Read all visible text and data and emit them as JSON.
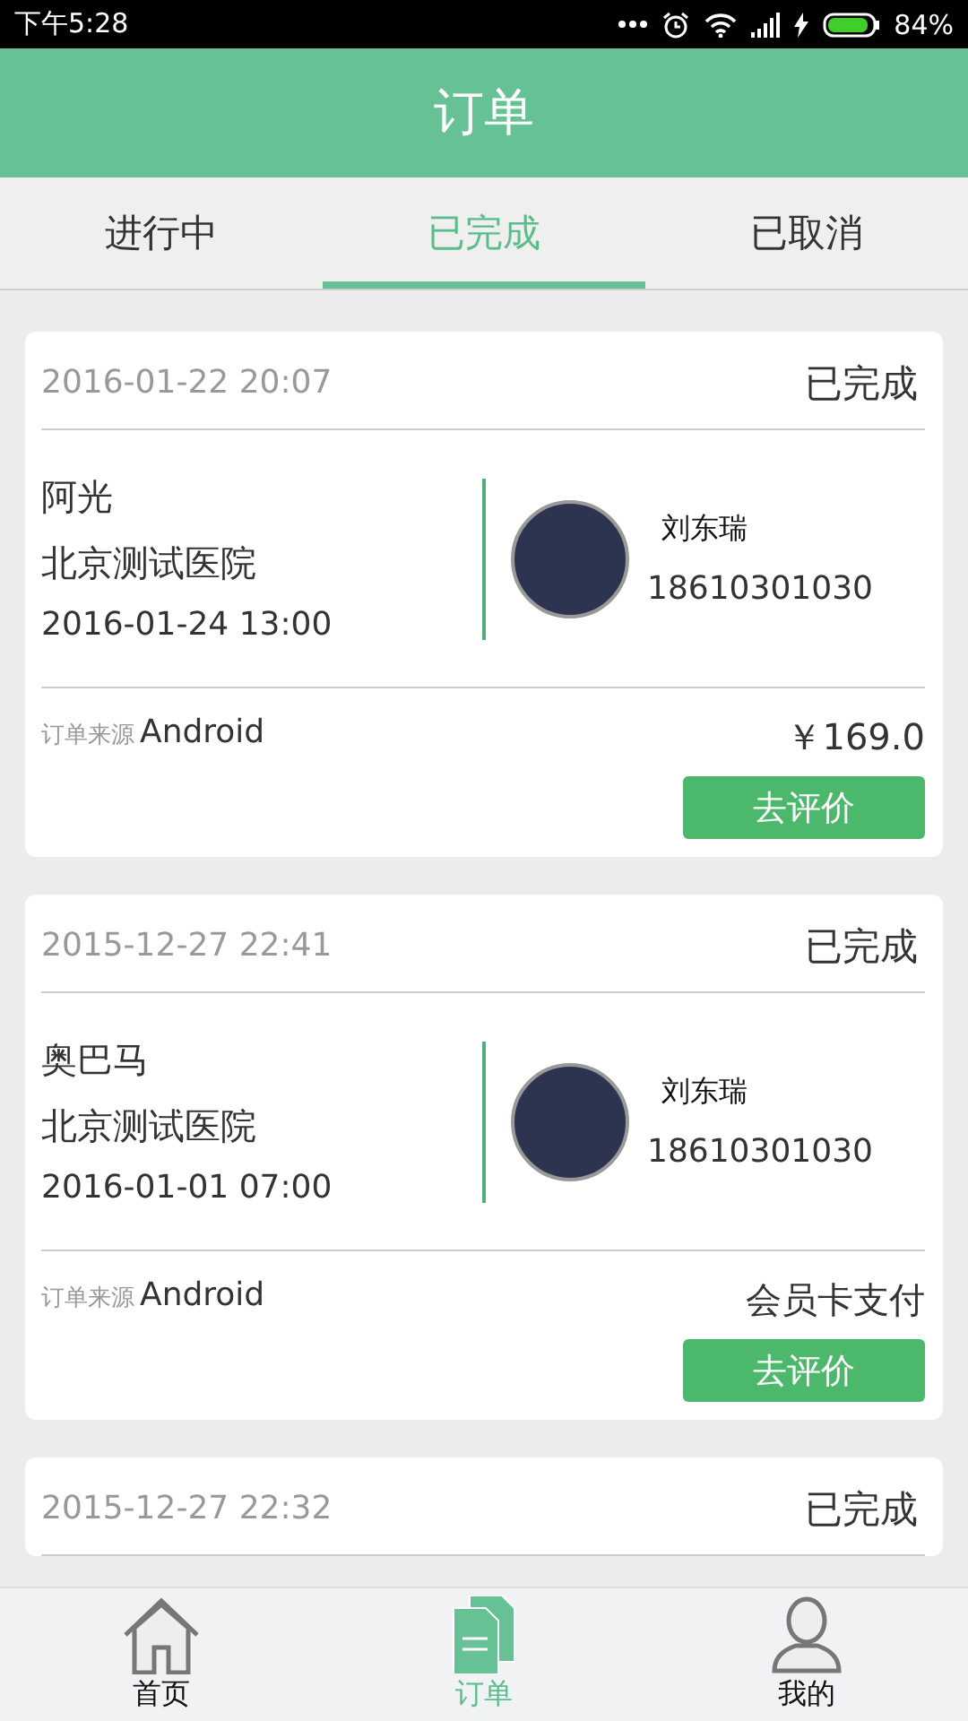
{
  "status_bar": {
    "time": "下午5:28",
    "battery": "84%"
  },
  "header": {
    "title": "订单"
  },
  "tabs": [
    {
      "label": "进行中",
      "selected": false
    },
    {
      "label": "已完成",
      "selected": true
    },
    {
      "label": "已取消",
      "selected": false
    }
  ],
  "orders": [
    {
      "created": "2016-01-22 20:07",
      "status": "已完成",
      "patient": "阿光",
      "hospital": "北京测试医院",
      "appointment": "2016-01-24 13:00",
      "doctor": "刘东瑞",
      "phone": "18610301030",
      "source_label": "订单来源",
      "source": "Android",
      "payment": "￥169.0",
      "action": "去评价"
    },
    {
      "created": "2015-12-27 22:41",
      "status": "已完成",
      "patient": "奥巴马",
      "hospital": "北京测试医院",
      "appointment": "2016-01-01 07:00",
      "doctor": "刘东瑞",
      "phone": "18610301030",
      "source_label": "订单来源",
      "source": "Android",
      "payment": "会员卡支付",
      "action": "去评价"
    },
    {
      "created": "2015-12-27 22:32",
      "status": "已完成"
    }
  ],
  "bottom_nav": [
    {
      "kind": "home",
      "label": "首页",
      "selected": false
    },
    {
      "kind": "orders",
      "label": "订单",
      "selected": true
    },
    {
      "kind": "profile",
      "label": "我的",
      "selected": false
    }
  ]
}
